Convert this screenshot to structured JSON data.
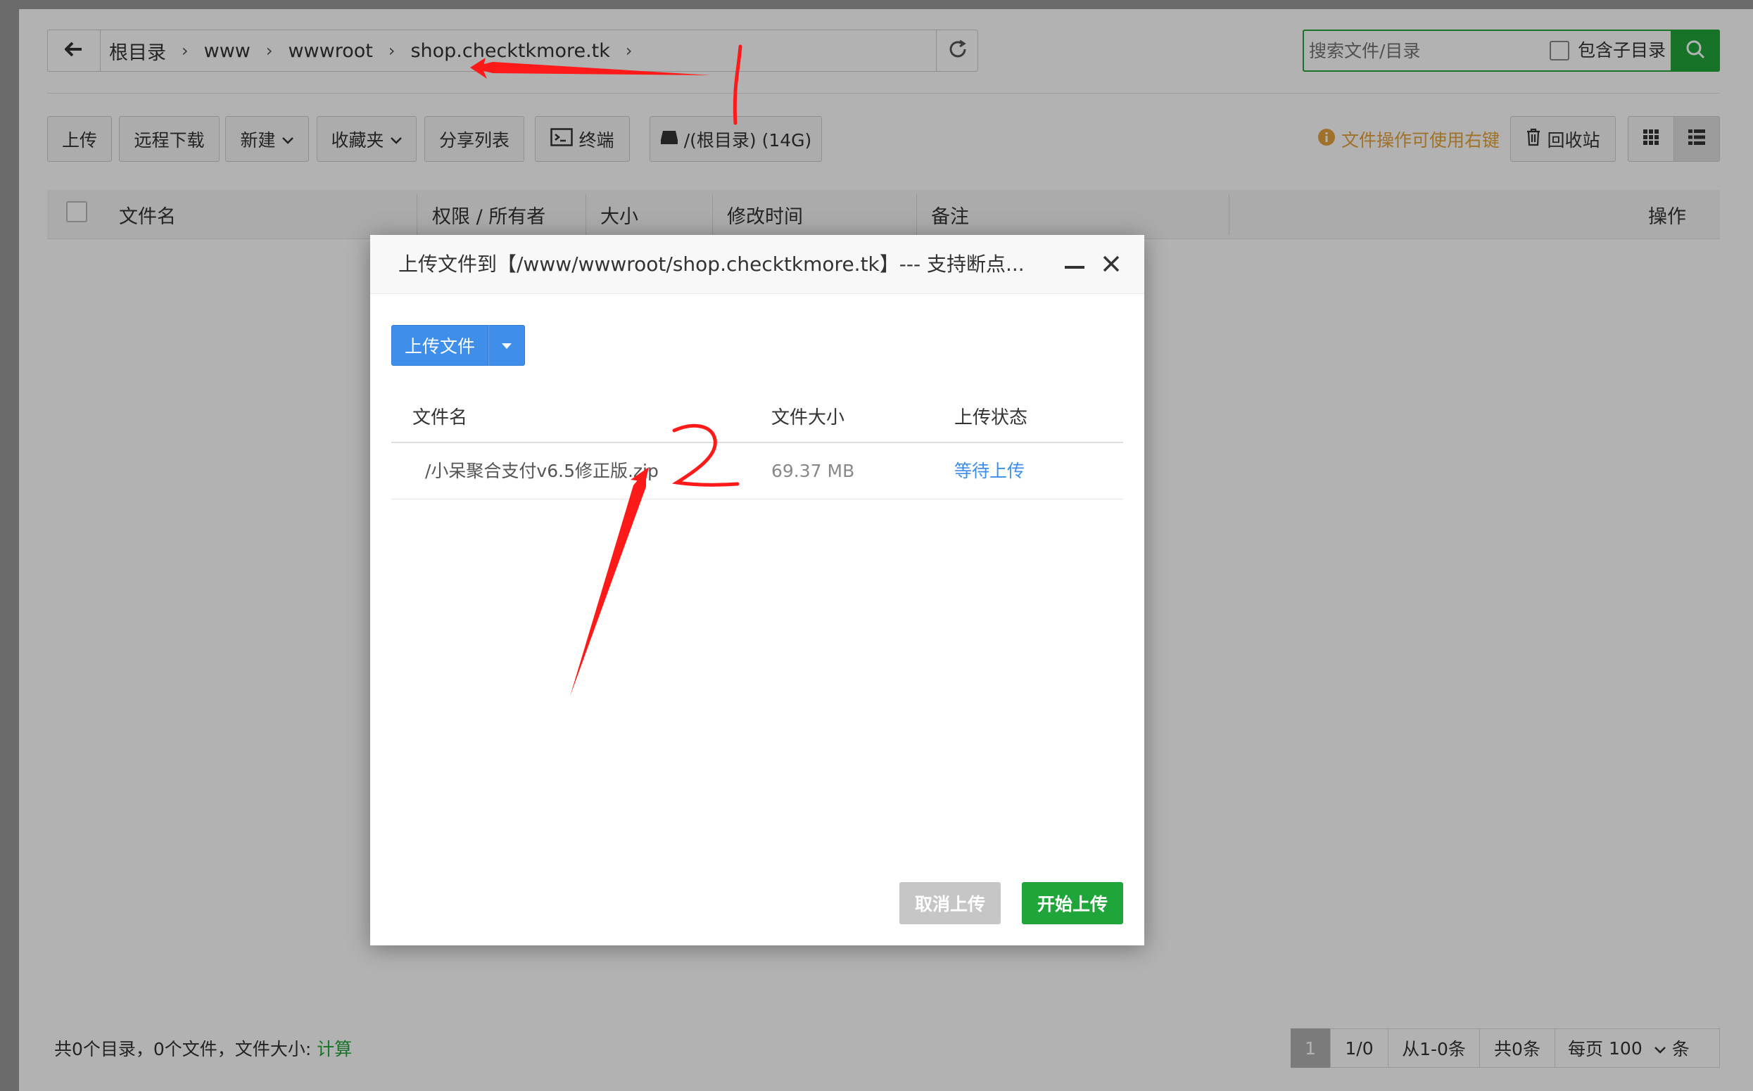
{
  "breadcrumb": {
    "items": [
      "根目录",
      "www",
      "wwwroot",
      "shop.checktkmore.tk"
    ]
  },
  "search": {
    "placeholder": "搜索文件/目录",
    "include_subdir_label": "包含子目录"
  },
  "toolbar": {
    "upload": "上传",
    "remote_download": "远程下载",
    "new": "新建",
    "favorites": "收藏夹",
    "share_list": "分享列表",
    "terminal": "终端",
    "disk": "/(根目录) (14G)",
    "hint": "文件操作可使用右键",
    "recycle_bin": "回收站"
  },
  "table": {
    "headers": {
      "filename": "文件名",
      "permission": "权限 / 所有者",
      "size": "大小",
      "modified": "修改时间",
      "remark": "备注",
      "actions": "操作"
    }
  },
  "footer": {
    "summary": "共0个目录，0个文件，文件大小:",
    "calc_link": "计算"
  },
  "pager": {
    "current": "1",
    "pages": "1/0",
    "range": "从1-0条",
    "total": "共0条",
    "per_page_label": "每页",
    "per_page_value": "100",
    "unit": "条"
  },
  "dialog": {
    "title": "上传文件到【/www/wwwroot/shop.checktkmore.tk】--- 支持断点...",
    "upload_button": "上传文件",
    "columns": {
      "name": "文件名",
      "size": "文件大小",
      "status": "上传状态"
    },
    "files": [
      {
        "name": "/小呆聚合支付v6.5修正版.zip",
        "size": "69.37 MB",
        "status": "等待上传"
      }
    ],
    "cancel_button": "取消上传",
    "start_button": "开始上传"
  },
  "colors": {
    "accent_green": "#20a53a",
    "primary_blue": "#3e8eea",
    "link_blue": "#3e8eea",
    "hint_orange": "#e6a23c",
    "annotation_red": "#ff1a1a"
  },
  "icons": [
    "back-arrow-icon",
    "refresh-icon",
    "search-icon",
    "terminal-icon",
    "disk-icon",
    "info-icon",
    "trash-icon",
    "grid-view-icon",
    "list-view-icon",
    "close-icon",
    "minimize-icon",
    "caret-down-icon"
  ]
}
